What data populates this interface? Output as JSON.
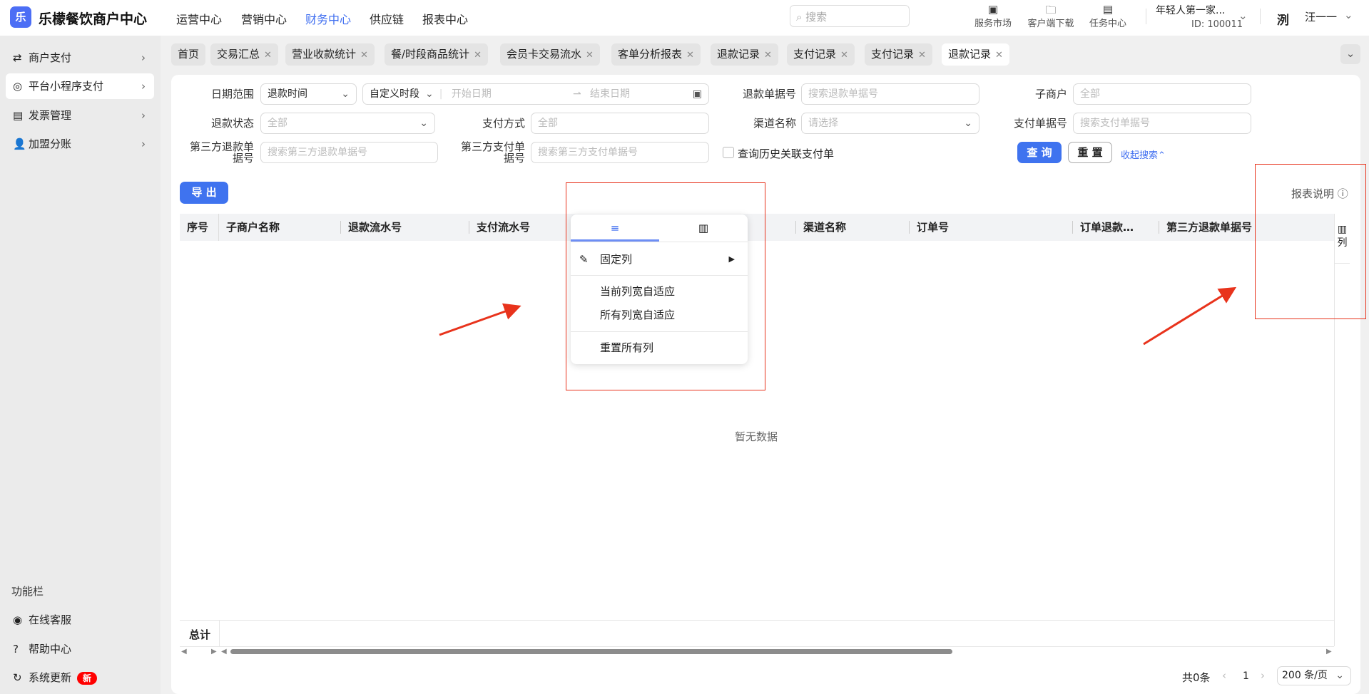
{
  "app": {
    "name": "乐檬餐饮商户中心",
    "logo": "乐"
  },
  "nav": [
    {
      "label": "运营中心"
    },
    {
      "label": "营销中心"
    },
    {
      "label": "财务中心",
      "active": true
    },
    {
      "label": "供应链"
    },
    {
      "label": "报表中心"
    }
  ],
  "search": {
    "placeholder": "搜索"
  },
  "tools": [
    {
      "label": "服务市场",
      "icon": "shop-bag-icon"
    },
    {
      "label": "客户端下载",
      "icon": "folder-download-icon"
    },
    {
      "label": "任务中心",
      "icon": "clipboard-check-icon"
    }
  ],
  "account": {
    "store": "年轻人第一家...",
    "id": "ID: 100011",
    "avatar_text": "洌",
    "user": "汪一一"
  },
  "sidebar": {
    "items": [
      {
        "label": "商户支付",
        "icon": "⇄"
      },
      {
        "label": "平台小程序支付",
        "icon": "◎",
        "active": true
      },
      {
        "label": "发票管理",
        "icon": "▤"
      },
      {
        "label": "加盟分账",
        "icon": "👤"
      }
    ],
    "section": "功能栏",
    "bottom": [
      {
        "label": "在线客服",
        "icon": "◉"
      },
      {
        "label": "帮助中心",
        "icon": "?"
      },
      {
        "label": "系统更新",
        "icon": "↻",
        "badge": "新"
      }
    ]
  },
  "tabs": [
    "首页",
    "交易汇总",
    "营业收款统计",
    "餐/时段商品统计",
    "会员卡交易流水",
    "客单分析报表",
    "退款记录",
    "支付记录",
    "支付记录",
    "退款记录"
  ],
  "filters": {
    "date_label": "日期范围",
    "date_type": "退款时间",
    "period": "自定义时段",
    "start": "开始日期",
    "end": "结束日期",
    "refund_no_label": "退款单据号",
    "refund_no_ph": "搜索退款单据号",
    "sub_label": "子商户",
    "sub_ph": "全部",
    "status_label": "退款状态",
    "status_ph": "全部",
    "pay_method_label": "支付方式",
    "pay_method_ph": "全部",
    "channel_label": "渠道名称",
    "channel_ph": "请选择",
    "pay_no_label": "支付单据号",
    "pay_no_ph": "搜索支付单据号",
    "third_refund_label": "第三方退款单据号",
    "third_refund_ph": "搜索第三方退款单据号",
    "third_pay_label": "第三方支付单据号",
    "third_pay_ph": "搜索第三方支付单据号",
    "history_label": "查询历史关联支付单",
    "query": "查 询",
    "reset": "重 置",
    "collapse": "收起搜索⌃"
  },
  "export": "导 出",
  "report_note": "报表说明",
  "columns": [
    "序号",
    "子商户名称",
    "退款流水号",
    "支付流水号",
    "渠道名称",
    "订单号",
    "订单退款…",
    "第三方退款单据号"
  ],
  "side_panel": "列",
  "empty": "暂无数据",
  "total": "总计",
  "popup": {
    "pin": "固定列",
    "fit_current": "当前列宽自适应",
    "fit_all": "所有列宽自适应",
    "reset_all": "重置所有列"
  },
  "pagination": {
    "total": "共0条",
    "page": "1",
    "size": "200 条/页"
  }
}
